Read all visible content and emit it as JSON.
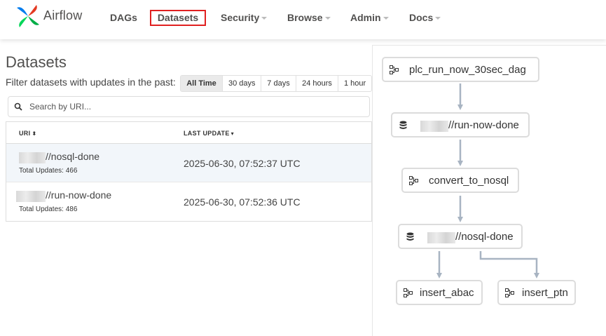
{
  "app": {
    "brand": "Airflow"
  },
  "nav": {
    "dags": "DAGs",
    "datasets": "Datasets",
    "security": "Security",
    "browse": "Browse",
    "admin": "Admin",
    "docs": "Docs"
  },
  "page": {
    "title": "Datasets",
    "filter_label": "Filter datasets with updates in the past:",
    "filters": [
      "All Time",
      "30 days",
      "7 days",
      "24 hours",
      "1 hour"
    ],
    "active_filter": "All Time",
    "search_placeholder": "Search by URI..."
  },
  "table": {
    "headers": {
      "uri": "URI",
      "last_update": "LAST UPDATE"
    },
    "rows": [
      {
        "uri": "//nosql-done",
        "updates": "Total Updates: 466",
        "last_update": "2025-06-30, 07:52:37 UTC"
      },
      {
        "uri": "//run-now-done",
        "updates": "Total Updates: 486",
        "last_update": "2025-06-30, 07:52:36 UTC"
      }
    ]
  },
  "graph": {
    "nodes": {
      "dag1": "plc_run_now_30sec_dag",
      "ds1": "//run-now-done",
      "dag2": "convert_to_nosql",
      "ds2": "//nosql-done",
      "dag3": "insert_abac",
      "dag4": "insert_ptn"
    }
  },
  "colors": {
    "accent_box": "#e02020",
    "edge": "#a8b4c2",
    "node_border": "#dcdcdc"
  },
  "icons": {
    "dag": "dag-icon",
    "dataset": "database-icon",
    "search": "search-icon"
  }
}
